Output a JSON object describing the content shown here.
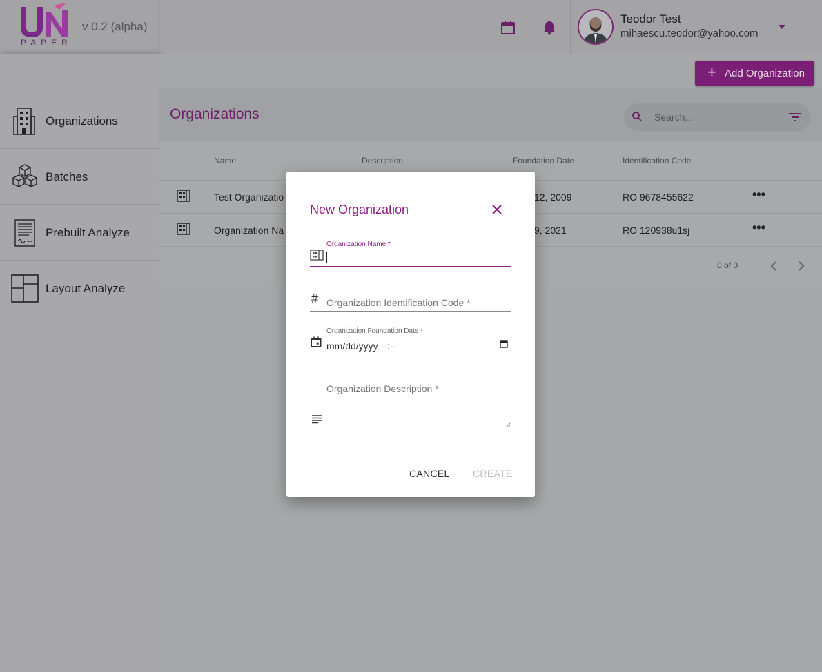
{
  "header": {
    "logo_text": "PAPER",
    "logo_mark": "UN",
    "version": "v 0.2 (alpha)",
    "calendar_icon": "calendar-icon",
    "bell_icon": "bell-icon",
    "user_name": "Teodor Test",
    "user_email": "mihaescu.teodor@yahoo.com"
  },
  "sidebar": {
    "items": [
      {
        "label": "Organizations",
        "icon": "building-icon"
      },
      {
        "label": "Batches",
        "icon": "boxes-icon"
      },
      {
        "label": "Prebuilt Analyze",
        "icon": "document-icon"
      },
      {
        "label": "Layout Analyze",
        "icon": "layout-icon"
      }
    ]
  },
  "main": {
    "add_button": "Add Organization",
    "title": "Organizations",
    "search_placeholder": "Search...",
    "columns": [
      "Name",
      "Description",
      "Foundation Date",
      "Identification Code"
    ],
    "rows": [
      {
        "name": "Test Organizatio",
        "date": "12, 2009",
        "code": "RO 9678455622"
      },
      {
        "name": "Organization Na",
        "date": "9, 2021",
        "code": "RO 120938u1sj"
      }
    ],
    "pagination": "0 of 0"
  },
  "dialog": {
    "title": "New Organization",
    "name_label": "Organization Name *",
    "name_value": "",
    "id_code_placeholder": "Organization Identification Code *",
    "date_label": "Organization Foundation Date *",
    "date_placeholder": "mm/dd/yyyy --:--",
    "description_placeholder": "Organization Description *",
    "cancel": "CANCEL",
    "create": "CREATE"
  },
  "colors": {
    "accent": "#8c1f86",
    "accent_dark": "#7b1f76"
  }
}
